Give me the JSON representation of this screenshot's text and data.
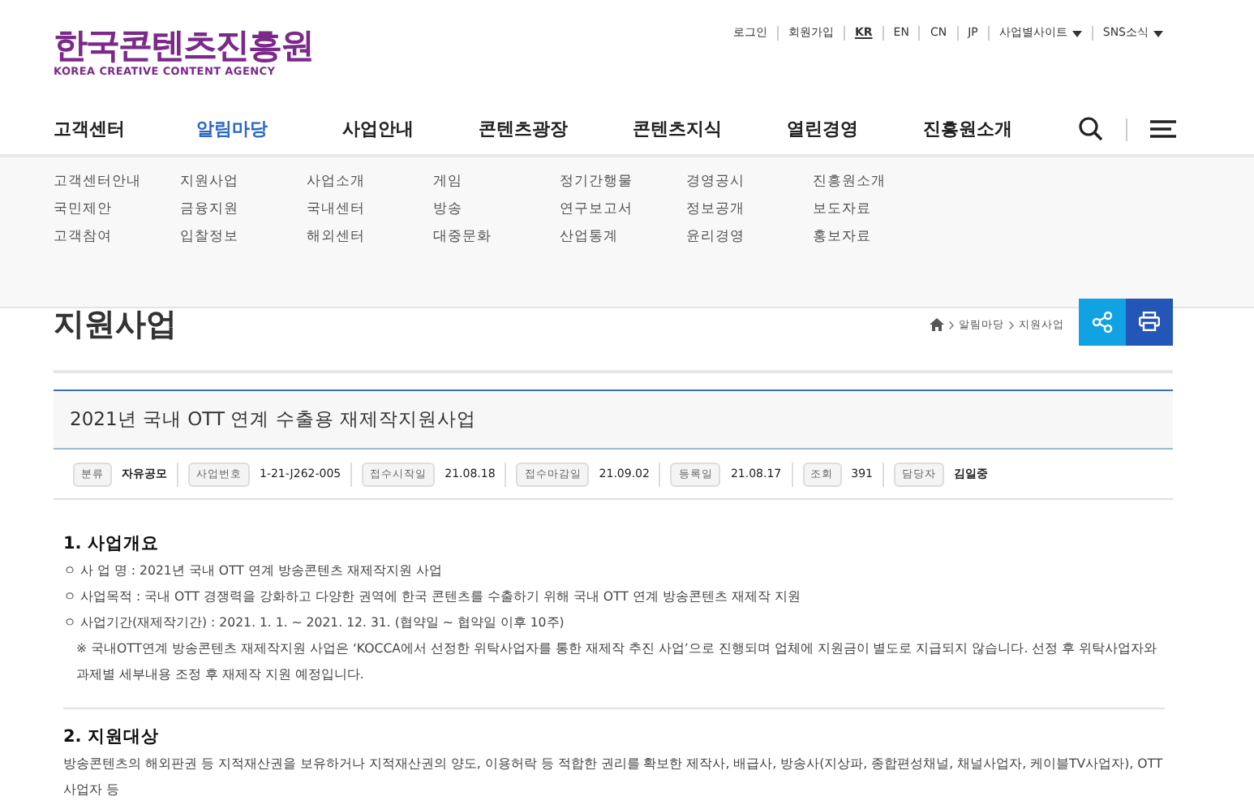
{
  "logo": {
    "title": "한국콘텐츠진흥원",
    "subtitle": "KOREA CREATIVE CONTENT AGENCY"
  },
  "util_links": [
    {
      "label": "로그인",
      "selected": false,
      "dropdown": false
    },
    {
      "label": "회원가입",
      "selected": false,
      "dropdown": false
    },
    {
      "label": "KR",
      "selected": true,
      "dropdown": false
    },
    {
      "label": "EN",
      "selected": false,
      "dropdown": false
    },
    {
      "label": "CN",
      "selected": false,
      "dropdown": false
    },
    {
      "label": "JP",
      "selected": false,
      "dropdown": false
    },
    {
      "label": "사업별사이트",
      "selected": false,
      "dropdown": true
    },
    {
      "label": "SNS소식",
      "selected": false,
      "dropdown": true
    }
  ],
  "nav": [
    {
      "label": "고객센터",
      "selected": false
    },
    {
      "label": "알림마당",
      "selected": true
    },
    {
      "label": "사업안내",
      "selected": false
    },
    {
      "label": "콘텐츠광장",
      "selected": false
    },
    {
      "label": "콘텐츠지식",
      "selected": false
    },
    {
      "label": "열린경영",
      "selected": false
    },
    {
      "label": "진흥원소개",
      "selected": false
    }
  ],
  "mega_menu": [
    [
      "고객센터안내",
      "국민제안",
      "고객참여"
    ],
    [
      "지원사업",
      "금융지원",
      "입찰정보"
    ],
    [
      "사업소개",
      "국내센터",
      "해외센터"
    ],
    [
      "게임",
      "방송",
      "대중문화"
    ],
    [
      "정기간행물",
      "연구보고서",
      "산업통계"
    ],
    [
      "경영공시",
      "정보공개",
      "윤리경영"
    ],
    [
      "진흥원소개",
      "보도자료",
      "홍보자료"
    ]
  ],
  "page_title": "지원사업",
  "breadcrumb": [
    "알림마당",
    "지원사업"
  ],
  "article": {
    "title": "2021년 국내 OTT 연계 수출용 재제작지원사업",
    "meta": [
      {
        "label": "분류",
        "value": "자유공모"
      },
      {
        "label": "사업번호",
        "value": "1-21-J262-005"
      },
      {
        "label": "접수시작일",
        "value": "21.08.18"
      },
      {
        "label": "접수마감일",
        "value": "21.09.02"
      },
      {
        "label": "등록일",
        "value": "21.08.17"
      },
      {
        "label": "조회",
        "value": "391"
      },
      {
        "label": "담당자",
        "value": "김일중"
      }
    ],
    "sections": [
      {
        "heading": "1. 사업개요",
        "lines": [
          {
            "kind": "bullet",
            "text": "ㅇ 사 업 명 : 2021년 국내 OTT 연계 방송콘텐츠 재제작지원 사업"
          },
          {
            "kind": "bullet",
            "text": "ㅇ 사업목적 : 국내 OTT 경쟁력을 강화하고 다양한 권역에 한국 콘텐츠를 수출하기 위해 국내 OTT 연계 방송콘텐츠 재제작 지원"
          },
          {
            "kind": "bullet",
            "text": "ㅇ 사업기간(재제작기간) : 2021. 1. 1. ~ 2021. 12. 31. (협약일 ~ 협약일 이후 10주)"
          },
          {
            "kind": "note",
            "text": "※ 국내OTT연계 방송콘텐츠 재제작지원 사업은 ‘KOCCA에서 선정한 위탁사업자를 통한 재제작 추진 사업’으로 진행되며 업체에 지원금이 별도로 지급되지 않습니다. 선정 후 위탁사업자와 과제별 세부내용 조정 후 재제작 지원 예정입니다."
          }
        ]
      },
      {
        "heading": "2. 지원대상",
        "lines": [
          {
            "kind": "plain",
            "text": "방송콘텐츠의 해외판권 등 지적재산권을 보유하거나 지적재산권의 양도, 이용허락 등 적합한 권리를 확보한 제작사, 배급사, 방송사(지상파, 종합편성채널, 채널사업자, 케이블TV사업자), OTT 사업자 등"
          }
        ]
      }
    ]
  }
}
